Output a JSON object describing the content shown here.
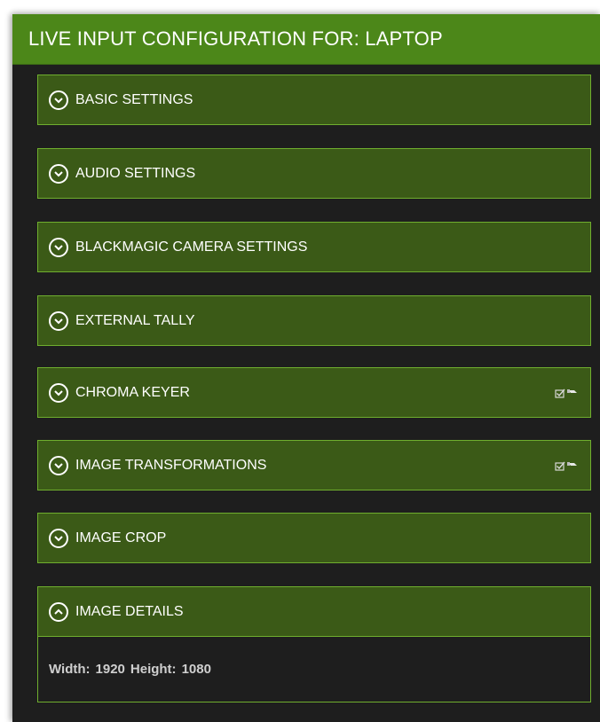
{
  "header": {
    "title": "LIVE INPUT CONFIGURATION FOR: LAPTOP"
  },
  "sections": [
    {
      "label": "BASIC SETTINGS",
      "expanded": false,
      "icon": "chevron-down-icon"
    },
    {
      "label": "AUDIO SETTINGS",
      "expanded": false,
      "icon": "chevron-down-icon"
    },
    {
      "label": "BLACKMAGIC CAMERA SETTINGS",
      "expanded": false,
      "icon": "chevron-down-icon"
    },
    {
      "label": "EXTERNAL TALLY",
      "expanded": false,
      "icon": "chevron-down-icon"
    },
    {
      "label": "CHROMA KEYER",
      "expanded": false,
      "icon": "chevron-down-icon",
      "badge_icon": "checkbox-edit-icon"
    },
    {
      "label": "IMAGE TRANSFORMATIONS",
      "expanded": false,
      "icon": "chevron-down-icon",
      "badge_icon": "checkbox-edit-icon"
    },
    {
      "label": "IMAGE CROP",
      "expanded": false,
      "icon": "chevron-down-icon"
    },
    {
      "label": "IMAGE DETAILS",
      "expanded": true,
      "icon": "chevron-up-icon"
    }
  ],
  "image_details": {
    "width_label": "Width:",
    "width_value": "1920",
    "height_label": "Height:",
    "height_value": "1080"
  },
  "colors": {
    "header_bg": "#4c8719",
    "section_bg": "#3b5a17",
    "section_border": "#6fae2e",
    "panel_bg": "#1e1e1e"
  }
}
